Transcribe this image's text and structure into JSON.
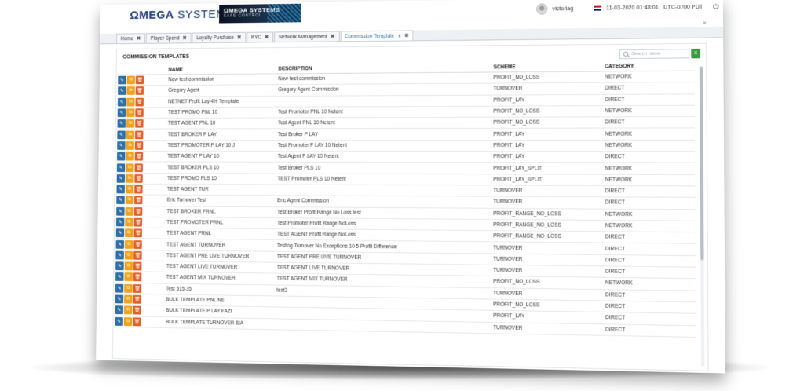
{
  "header": {
    "logo_omega": "ΩMEGA",
    "logo_systems": " SYSTEMS",
    "badge_line1": "ΩMEGA SYSTEMS",
    "badge_line2": "SAFE CONTROL",
    "username": "victoriag",
    "datetime": "11-03-2020 01:48:01",
    "timezone": "UTC-0700 PDT",
    "power_icon": "power-icon"
  },
  "tabs": [
    {
      "label": "Home",
      "close": "✖"
    },
    {
      "label": "Player Spend",
      "close": "✖"
    },
    {
      "label": "Loyalty Purchase",
      "close": "✖"
    },
    {
      "label": "KYC",
      "close": "✖"
    },
    {
      "label": "Network Management",
      "close": "✖"
    },
    {
      "label": "Commission Template",
      "close": "✖",
      "active": true
    }
  ],
  "panel": {
    "title": "COMMISSION TEMPLATES",
    "search_placeholder": "Search name",
    "close": "×"
  },
  "table": {
    "columns": {
      "name": "NAME",
      "description": "DESCRIPTION",
      "scheme": "SCHEME",
      "category": "CATEGORY"
    },
    "rows": [
      {
        "name": "New test commission",
        "description": "New test commission",
        "scheme": "PROFIT_NO_LOSS",
        "category": "NETWORK"
      },
      {
        "name": "Gregory Agent",
        "description": "Gregory Agent Commission",
        "scheme": "TURNOVER",
        "category": "DIRECT"
      },
      {
        "name": "NETNET Profit Lay 4% Template",
        "description": "",
        "scheme": "PROFIT_LAY",
        "category": "DIRECT"
      },
      {
        "name": "TEST PROMO PNL 10",
        "description": "Test Promoter PNL 10 Netent",
        "scheme": "PROFIT_NO_LOSS",
        "category": "NETWORK"
      },
      {
        "name": "TEST AGENT PNL 10",
        "description": "Test Agent PNL 10 Netent",
        "scheme": "PROFIT_NO_LOSS",
        "category": "DIRECT"
      },
      {
        "name": "TEST BROKER P LAY",
        "description": "Test Broker P LAY",
        "scheme": "PROFIT_LAY",
        "category": "NETWORK"
      },
      {
        "name": "TEST PROMOTER P LAY 10 J",
        "description": "Test Promoter P LAY 10 Netent",
        "scheme": "PROFIT_LAY",
        "category": "NETWORK"
      },
      {
        "name": "TEST AGENT P LAY 10",
        "description": "Test Agent P LAY 10 Netent",
        "scheme": "PROFIT_LAY",
        "category": "DIRECT"
      },
      {
        "name": "TEST BROKER PLS 10",
        "description": "Test Broker PLS 10",
        "scheme": "PROFIT_LAY_SPLIT",
        "category": "NETWORK"
      },
      {
        "name": "TEST PROMO PLS 10",
        "description": "TEST Promoter PLS 10 Netent",
        "scheme": "PROFIT_LAY_SPLIT",
        "category": "NETWORK"
      },
      {
        "name": "TEST AGENT TUR",
        "description": "",
        "scheme": "TURNOVER",
        "category": "DIRECT"
      },
      {
        "name": "Eric Turnover Test",
        "description": "Eric Agent Commission",
        "scheme": "TURNOVER",
        "category": "DIRECT"
      },
      {
        "name": "TEST BROKER PRNL",
        "description": "Test Broker Profit Range No Loss test",
        "scheme": "PROFIT_RANGE_NO_LOSS",
        "category": "NETWORK"
      },
      {
        "name": "TEST PROMOTER PRNL",
        "description": "Test Promoter Profit Range NoLoss",
        "scheme": "PROFIT_RANGE_NO_LOSS",
        "category": "NETWORK"
      },
      {
        "name": "TEST AGENT PRNL",
        "description": "TEST AGENT Profit Range NoLoss",
        "scheme": "PROFIT_RANGE_NO_LOSS",
        "category": "DIRECT"
      },
      {
        "name": "TEST AGENT TURNOVER",
        "description": "Testing Turnover No Exceptions 10 5 Profit Difference",
        "scheme": "TURNOVER",
        "category": "DIRECT"
      },
      {
        "name": "TEST AGENT PRE LIVE TURNOVER",
        "description": "TEST AGENT PRE LIVE TURNOVER",
        "scheme": "TURNOVER",
        "category": "DIRECT"
      },
      {
        "name": "TEST AGENT LIVE TURNOVER",
        "description": "TEST AGENT LIVE TURNOVER",
        "scheme": "TURNOVER",
        "category": "DIRECT"
      },
      {
        "name": "TEST AGENT MIX TURNOVER",
        "description": "TEST AGENT MIX TURNOVER",
        "scheme": "PROFIT_NO_LOSS",
        "category": "NETWORK"
      },
      {
        "name": "Test 515-35",
        "description": "test2",
        "scheme": "TURNOVER",
        "category": "DIRECT"
      },
      {
        "name": "BULK TEMPLATE PNL NE",
        "description": "",
        "scheme": "PROFIT_NO_LOSS",
        "category": "DIRECT"
      },
      {
        "name": "BULK TEMPLATE P LAY FAZI",
        "description": "",
        "scheme": "PROFIT_LAY",
        "category": "DIRECT"
      },
      {
        "name": "BULK TEMPLATE TURNOVER BIA",
        "description": "",
        "scheme": "TURNOVER",
        "category": "DIRECT"
      }
    ]
  },
  "icons": {
    "edit": "✎",
    "copy": "⧉",
    "delete": "🗑",
    "excel": "X",
    "pin": "⇟"
  },
  "colors": {
    "edit_button": "#2f6fa7",
    "copy_button": "#f0a21b",
    "delete_button": "#e2602a",
    "active_tab_text": "#1f6fb4",
    "brand": "#1d3a78",
    "excel_button": "#3a9a3e"
  }
}
